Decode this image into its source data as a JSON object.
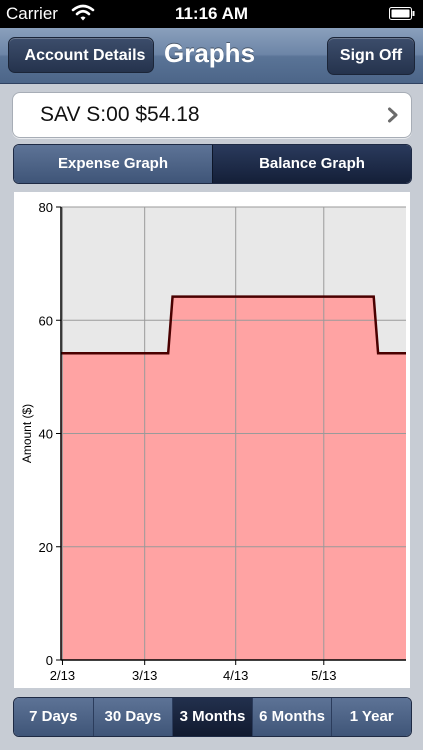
{
  "status_bar": {
    "carrier": "Carrier",
    "time": "11:16 AM"
  },
  "nav": {
    "back_label": "Account Details",
    "title": "Graphs",
    "signoff_label": "Sign Off"
  },
  "account": {
    "label": "SAV S:00 $54.18"
  },
  "graph_tabs": [
    {
      "label": "Expense Graph",
      "selected": false
    },
    {
      "label": "Balance Graph",
      "selected": true
    }
  ],
  "ranges": [
    {
      "label": "7 Days",
      "selected": false
    },
    {
      "label": "30 Days",
      "selected": false
    },
    {
      "label": "3 Months",
      "selected": true
    },
    {
      "label": "6 Months",
      "selected": false
    },
    {
      "label": "1 Year",
      "selected": false
    }
  ],
  "colors": {
    "fill": "#ffa3a3",
    "line": "#4a0000",
    "plot_bg": "#e8e8e8"
  },
  "chart_data": {
    "type": "area",
    "ylabel": "Amount ($)",
    "xlabel": "",
    "title": "",
    "ylim": [
      0,
      80
    ],
    "yticks": [
      0,
      20,
      40,
      60,
      80
    ],
    "x_ticks": [
      {
        "label": "2/13",
        "day": 0
      },
      {
        "label": "3/13",
        "day": 28
      },
      {
        "label": "4/13",
        "day": 59
      },
      {
        "label": "5/13",
        "day": 89
      }
    ],
    "xlim_days": [
      -0.5,
      117
    ],
    "series": [
      {
        "points": [
          {
            "day": -0.5,
            "value": 54.18
          },
          {
            "day": 36,
            "value": 54.18
          },
          {
            "day": 37.5,
            "value": 64.18
          },
          {
            "day": 106,
            "value": 64.18
          },
          {
            "day": 107.5,
            "value": 54.18
          },
          {
            "day": 117,
            "value": 54.18
          }
        ]
      }
    ]
  }
}
